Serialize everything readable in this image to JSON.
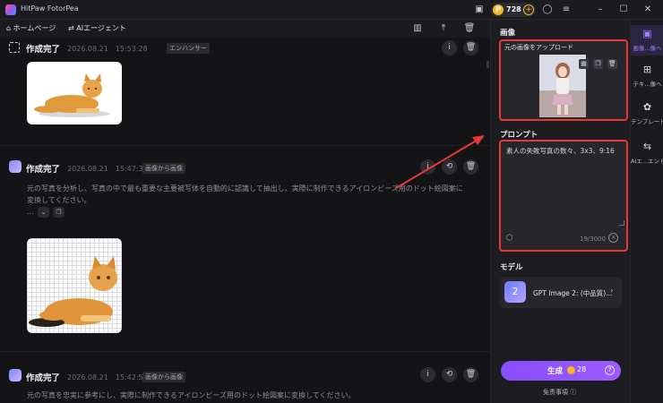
{
  "app": {
    "title": "HitPaw FotorPea",
    "coins": "728"
  },
  "toolbar": {
    "home": "ホームページ",
    "agent": "AIエージェント"
  },
  "entries": [
    {
      "title": "作成完了",
      "date": "2026.08.21　15:53:28",
      "tag": "エンハンサー"
    },
    {
      "title": "作成完了",
      "date": "2026.08.21　15:47:35",
      "tag": "画像から画像",
      "desc_line1": "元の写真を分析し、写真の中で最も重要な主要被写体を自動的に認識して抽出し、実際に制作できるアイロンビーズ用のドット絵図案に",
      "desc_line2": "変換してください。",
      "ellipsis": "..."
    },
    {
      "title": "作成完了",
      "date": "2026.08.21　15:42:57",
      "tag": "画像から画像",
      "desc_line1": "元の写真を忠実に参考にし、実際に制作できるアイロンビーズ用のドット絵図案に変換してください。"
    }
  ],
  "panel": {
    "image_heading": "画像",
    "upload_label": "元の画像をアップロード",
    "prompt_heading": "プロンプト",
    "prompt_value": "素人の失敗写真の数々、3x3、9:16",
    "char_count": "19/3000",
    "model_heading": "モデル",
    "model_name": "GPT Image 2: (中品質)...",
    "model_thumb_text": "2",
    "generate_label": "生成",
    "generate_cost": "28",
    "disclaimer": "免责事項"
  },
  "rail": [
    {
      "label": "画像...像へ",
      "active": true
    },
    {
      "label": "テキ...像へ",
      "active": false
    },
    {
      "label": "テンプレート",
      "active": false
    },
    {
      "label": "AIエ...エント",
      "active": false
    }
  ],
  "colors": {
    "accent": "#8a4dff",
    "highlight_border": "#e53935",
    "coin": "#f5b524"
  }
}
